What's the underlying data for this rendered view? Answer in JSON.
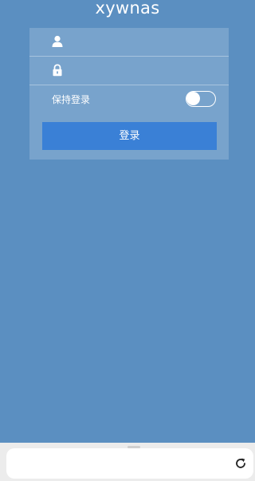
{
  "app": {
    "title": "xywnas"
  },
  "login_form": {
    "username_field": {
      "value": "",
      "placeholder": "",
      "icon": "user-icon"
    },
    "password_field": {
      "value": "",
      "placeholder": "",
      "icon": "lock-icon"
    },
    "remember_label": "保持登录",
    "remember_toggle_on": false,
    "submit_label": "登录"
  },
  "browser_bar": {
    "url": "",
    "reload_icon": "reload-icon"
  },
  "colors": {
    "background": "#5b8fc1",
    "panel": "rgba(255,255,255,0.18)",
    "button": "#3a80d6",
    "text": "#ffffff"
  }
}
